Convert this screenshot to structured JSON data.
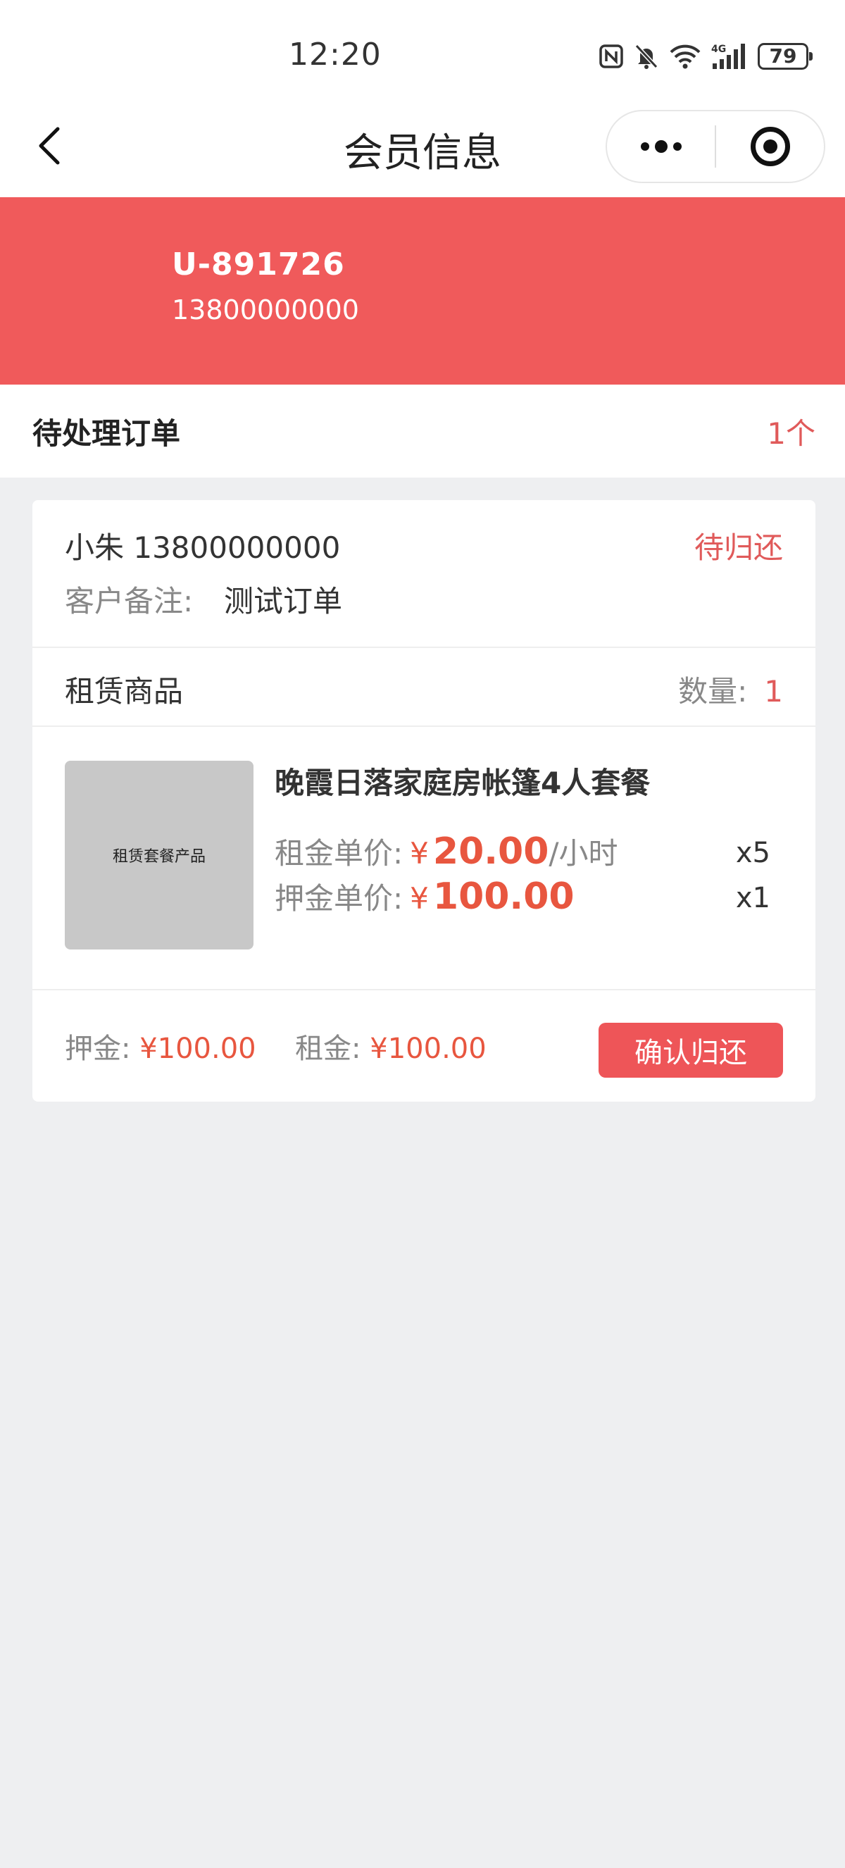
{
  "status_bar": {
    "time": "12:20",
    "icons": [
      "nfc-icon",
      "mute-icon",
      "wifi-icon",
      "4g-signal-icon"
    ],
    "battery": "79"
  },
  "nav": {
    "title": "会员信息",
    "back_icon": "chevron-left-icon",
    "more_icon": "more-dots-icon",
    "close_icon": "target-icon"
  },
  "member": {
    "id": "U-891726",
    "phone": "13800000000",
    "banner_color": "#f05a5b"
  },
  "pending": {
    "title": "待处理订单",
    "count": "1个"
  },
  "order": {
    "customer": "小朱 13800000000",
    "status": "待归还",
    "remark_label": "客户备注:",
    "remark_value": "测试订单",
    "goods_title": "租赁商品",
    "qty_label": "数量:",
    "qty_value": "1",
    "product": {
      "thumb_text": "租赁套餐产品",
      "name": "晚霞日落家庭房帐篷4人套餐",
      "rent_label": "租金单价:",
      "rent_yen": "¥",
      "rent_price": "20.00",
      "rent_unit": "/小时",
      "rent_mult": "x5",
      "deposit_label": "押金单价:",
      "deposit_yen": "¥",
      "deposit_price": "100.00",
      "deposit_mult": "x1"
    },
    "footer": {
      "deposit_label": "押金:",
      "deposit_amount": "¥100.00",
      "rent_label": "租金:",
      "rent_amount": "¥100.00",
      "confirm_label": "确认归还"
    }
  },
  "colors": {
    "accent": "#e05a5a",
    "price": "#e8563f",
    "button": "#ee5558",
    "background": "#eeeff1"
  }
}
